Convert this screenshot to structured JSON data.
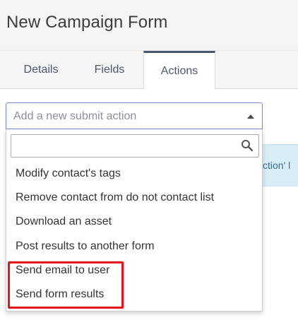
{
  "page": {
    "title": "New Campaign Form"
  },
  "tabs": [
    {
      "label": "Details",
      "active": false
    },
    {
      "label": "Fields",
      "active": false
    },
    {
      "label": "Actions",
      "active": true
    }
  ],
  "submit_action_select": {
    "placeholder": "Add a new submit action",
    "search_value": "",
    "options": [
      "Modify contact's tags",
      "Remove contact from do not contact list",
      "Download an asset",
      "Post results to another form",
      "Send email to user",
      "Send form results"
    ]
  },
  "info_banner": {
    "text": "ction' l"
  },
  "annotation": {
    "highlight_color": "#e8141c",
    "highlighted_options": [
      "Send email to user",
      "Send form results"
    ]
  },
  "colors": {
    "accent": "#4a5572",
    "select_border": "#6f8ac8",
    "info_bg": "#d9edf7"
  }
}
